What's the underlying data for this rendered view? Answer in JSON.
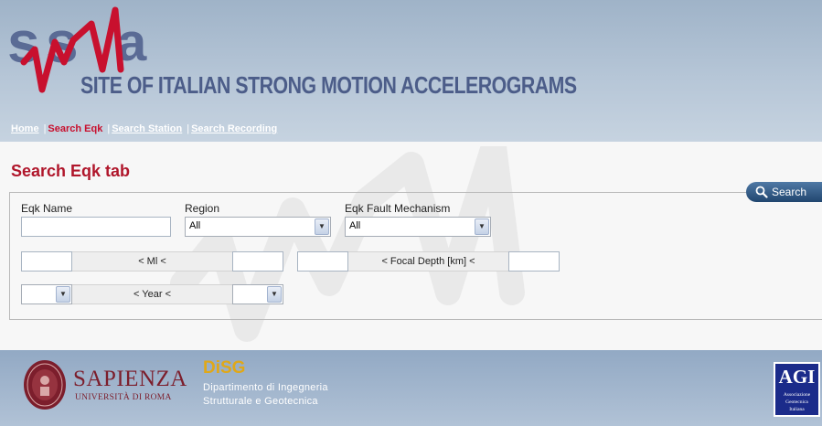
{
  "header": {
    "logo_text": "sisMa",
    "site_title": "SITE OF ITALIAN STRONG MOTION ACCELEROGRAMS",
    "nav": [
      {
        "label": "Home"
      },
      {
        "label": "Search Eqk"
      },
      {
        "label": "Search Station"
      },
      {
        "label": "Search Recording"
      }
    ],
    "nav_separator": "|"
  },
  "main": {
    "title": "Search Eqk tab",
    "form": {
      "eqk_name_label": "Eqk Name",
      "eqk_name_value": "",
      "region_label": "Region",
      "region_value": "All",
      "fault_label": "Eqk Fault Mechanism",
      "fault_value": "All",
      "ml_label": "< Ml <",
      "ml_min": "",
      "ml_max": "",
      "focal_label": "< Focal Depth [km] <",
      "focal_min": "",
      "focal_max": "",
      "year_label": "< Year <",
      "year_min": "",
      "year_max": ""
    },
    "search_button": "Search"
  },
  "footer": {
    "sapienza_name": "SAPIENZA",
    "sapienza_sub": "UNIVERSITÀ DI ROMA",
    "disc_name": "DiSG",
    "disc_line1": "Dipartimento di Ingegneria",
    "disc_line2": "Strutturale e Geotecnica",
    "agi_short": "AGI",
    "agi_line1": "Associazione",
    "agi_line2": "Geotecnica",
    "agi_line3": "Italiana"
  },
  "colors": {
    "accent_red": "#b0162b",
    "title_blue": "#4c5d89",
    "button_blue": "#2f5683",
    "disc_gold": "#e0a818"
  },
  "icons": {
    "dropdown": "chevron-down-icon",
    "search": "magnifier-icon"
  }
}
